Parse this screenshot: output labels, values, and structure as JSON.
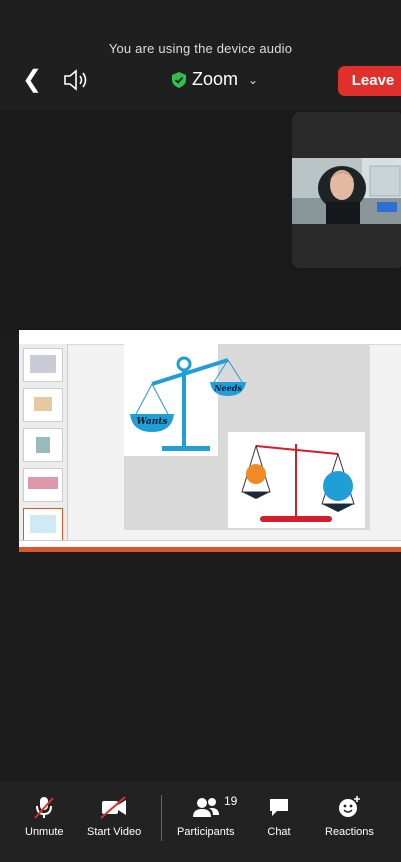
{
  "topbar": {
    "audio_message": "You are using the device audio",
    "meeting_title": "Zoom",
    "leave_label": "Leave"
  },
  "share": {
    "slide": {
      "left_pan_label": "Wants",
      "right_pan_label": "Needs"
    }
  },
  "toolbar": {
    "unmute_label": "Unmute",
    "start_video_label": "Start Video",
    "participants_label": "Participants",
    "participants_count": "19",
    "chat_label": "Chat",
    "reactions_label": "Reactions"
  },
  "colors": {
    "leave": "#e0302b",
    "shield": "#2fbf4a",
    "scale_blue": "#1f9fd6",
    "scale_red": "#d21f2b"
  }
}
